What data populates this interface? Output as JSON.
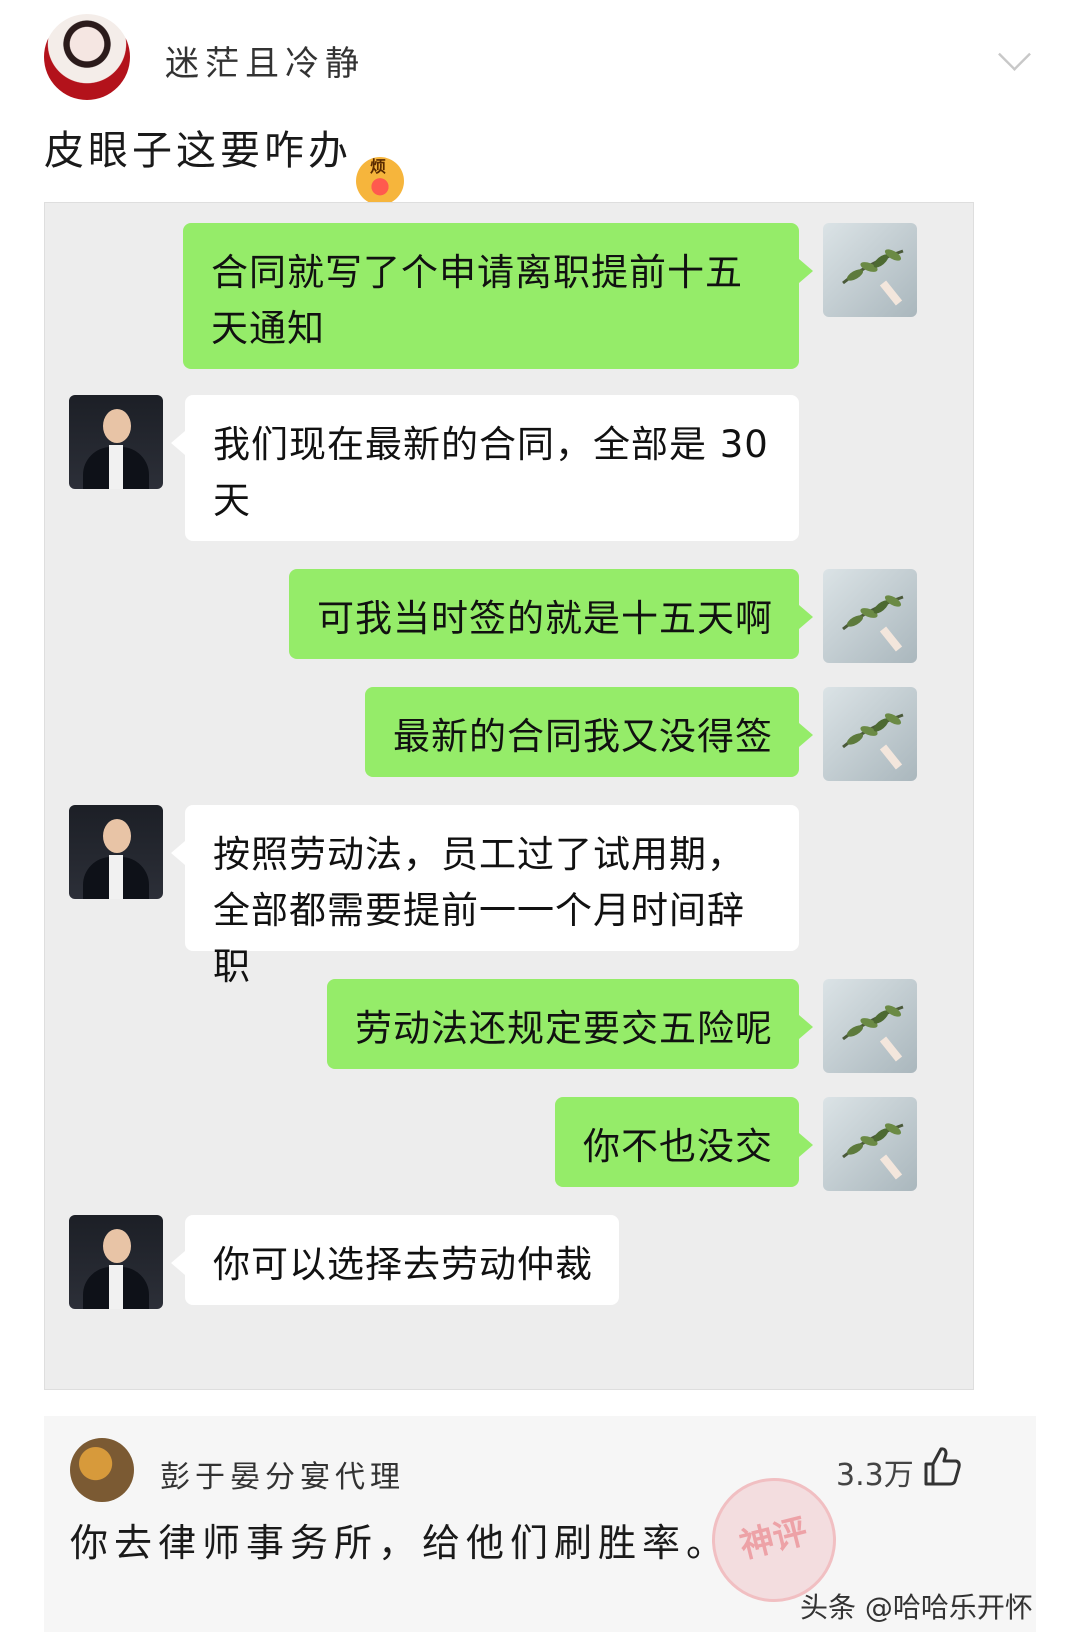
{
  "post": {
    "author": "迷茫且冷静",
    "text": "皮眼子这要咋办",
    "emoji_label": "烦"
  },
  "chat": {
    "messages": [
      {
        "from": "me",
        "text": "合同就写了个申请离职提前十五天通知"
      },
      {
        "from": "them",
        "text": "我们现在最新的合同，全部是 30 天"
      },
      {
        "from": "me",
        "text": "可我当时签的就是十五天啊"
      },
      {
        "from": "me",
        "text": "最新的合同我又没得签"
      },
      {
        "from": "them",
        "text": "按照劳动法，员工过了试用期，全部都需要提前一一个月时间辞职"
      },
      {
        "from": "me",
        "text": "劳动法还规定要交五险呢"
      },
      {
        "from": "me",
        "text": "你不也没交"
      },
      {
        "from": "them",
        "text": "你可以选择去劳动仲裁"
      }
    ]
  },
  "comment": {
    "author": "彭于晏分宴代理",
    "likes": "3.3万",
    "text": "你去律师事务所，给他们刷胜率。",
    "badge": "神评"
  },
  "watermark": "头条 @哈哈乐开怀"
}
